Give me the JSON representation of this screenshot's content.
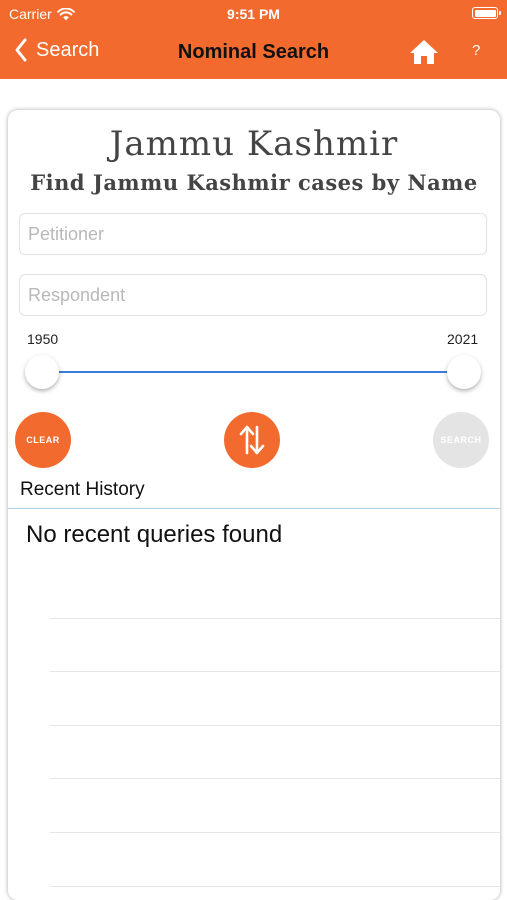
{
  "status_bar": {
    "carrier": "Carrier",
    "time": "9:51 PM"
  },
  "nav": {
    "back_label": "Search",
    "title": "Nominal Search",
    "help_label": "?"
  },
  "header": {
    "title": "Jammu Kashmir",
    "subtitle": "Find Jammu Kashmir cases by Name"
  },
  "form": {
    "petitioner_placeholder": "Petitioner",
    "respondent_placeholder": "Respondent",
    "year_min_label": "1950",
    "year_max_label": "2021",
    "year_range": [
      1950,
      2021
    ]
  },
  "buttons": {
    "clear_label": "CLEAR",
    "search_label": "SEARCH"
  },
  "history": {
    "label": "Recent History",
    "empty_message": "No recent queries found"
  },
  "colors": {
    "accent": "#f26a2e",
    "slider": "#3b7ddd",
    "disabled": "#e4e4e4"
  }
}
